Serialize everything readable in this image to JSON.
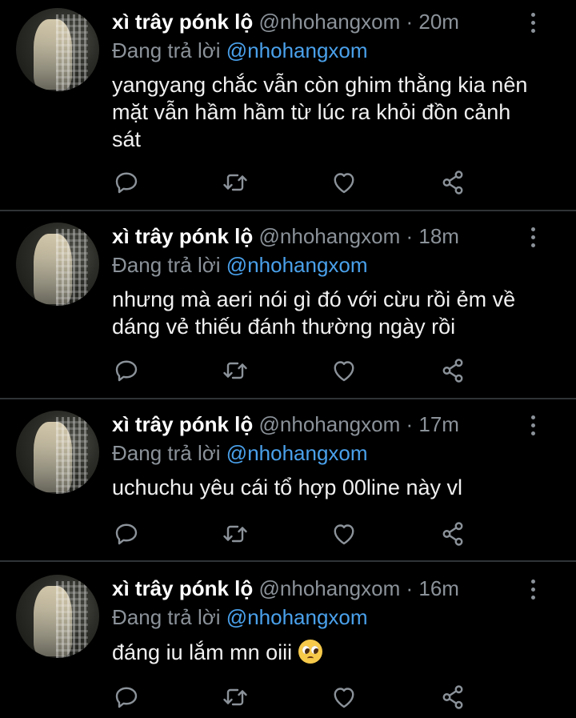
{
  "colors": {
    "background": "#000000",
    "name": "#ffffff",
    "muted": "#8b9299",
    "mention": "#4aa1eb",
    "divider": "#2f3336",
    "body_text": "#f0f0f0"
  },
  "tweets": [
    {
      "name": "xì trây pónk lộ",
      "handle": "@nhohangxom",
      "dot": "·",
      "time": "20m",
      "reply_prefix": "Đang trả lời",
      "reply_to": "@nhohangxom",
      "text": "yangyang chắc vẫn còn ghim thằng kia nên mặt vẫn hầm hầm từ lúc ra khỏi đồn cảnh sát",
      "actions": [
        "reply-icon",
        "retweet-icon",
        "like-icon",
        "share-icon"
      ]
    },
    {
      "name": "xì trây pónk lộ",
      "handle": "@nhohangxom",
      "dot": "·",
      "time": "18m",
      "reply_prefix": "Đang trả lời",
      "reply_to": "@nhohangxom",
      "text": "nhưng mà aeri nói gì đó với cừu rồi ẻm về dáng vẻ thiếu đánh thường ngày rồi",
      "actions": [
        "reply-icon",
        "retweet-icon",
        "like-icon",
        "share-icon"
      ]
    },
    {
      "name": "xì trây pónk lộ",
      "handle": "@nhohangxom",
      "dot": "·",
      "time": "17m",
      "reply_prefix": "Đang trả lời",
      "reply_to": "@nhohangxom",
      "text": "uchuchu yêu cái tổ hợp 00line này vl",
      "actions": [
        "reply-icon",
        "retweet-icon",
        "like-icon",
        "share-icon"
      ]
    },
    {
      "name": "xì trây pónk lộ",
      "handle": "@nhohangxom",
      "dot": "·",
      "time": "16m",
      "reply_prefix": "Đang trả lời",
      "reply_to": "@nhohangxom",
      "text": "đáng iu lắm mn oiii",
      "emoji": "pleading-face-emoji",
      "actions": [
        "reply-icon",
        "retweet-icon",
        "like-icon",
        "share-icon"
      ]
    }
  ]
}
